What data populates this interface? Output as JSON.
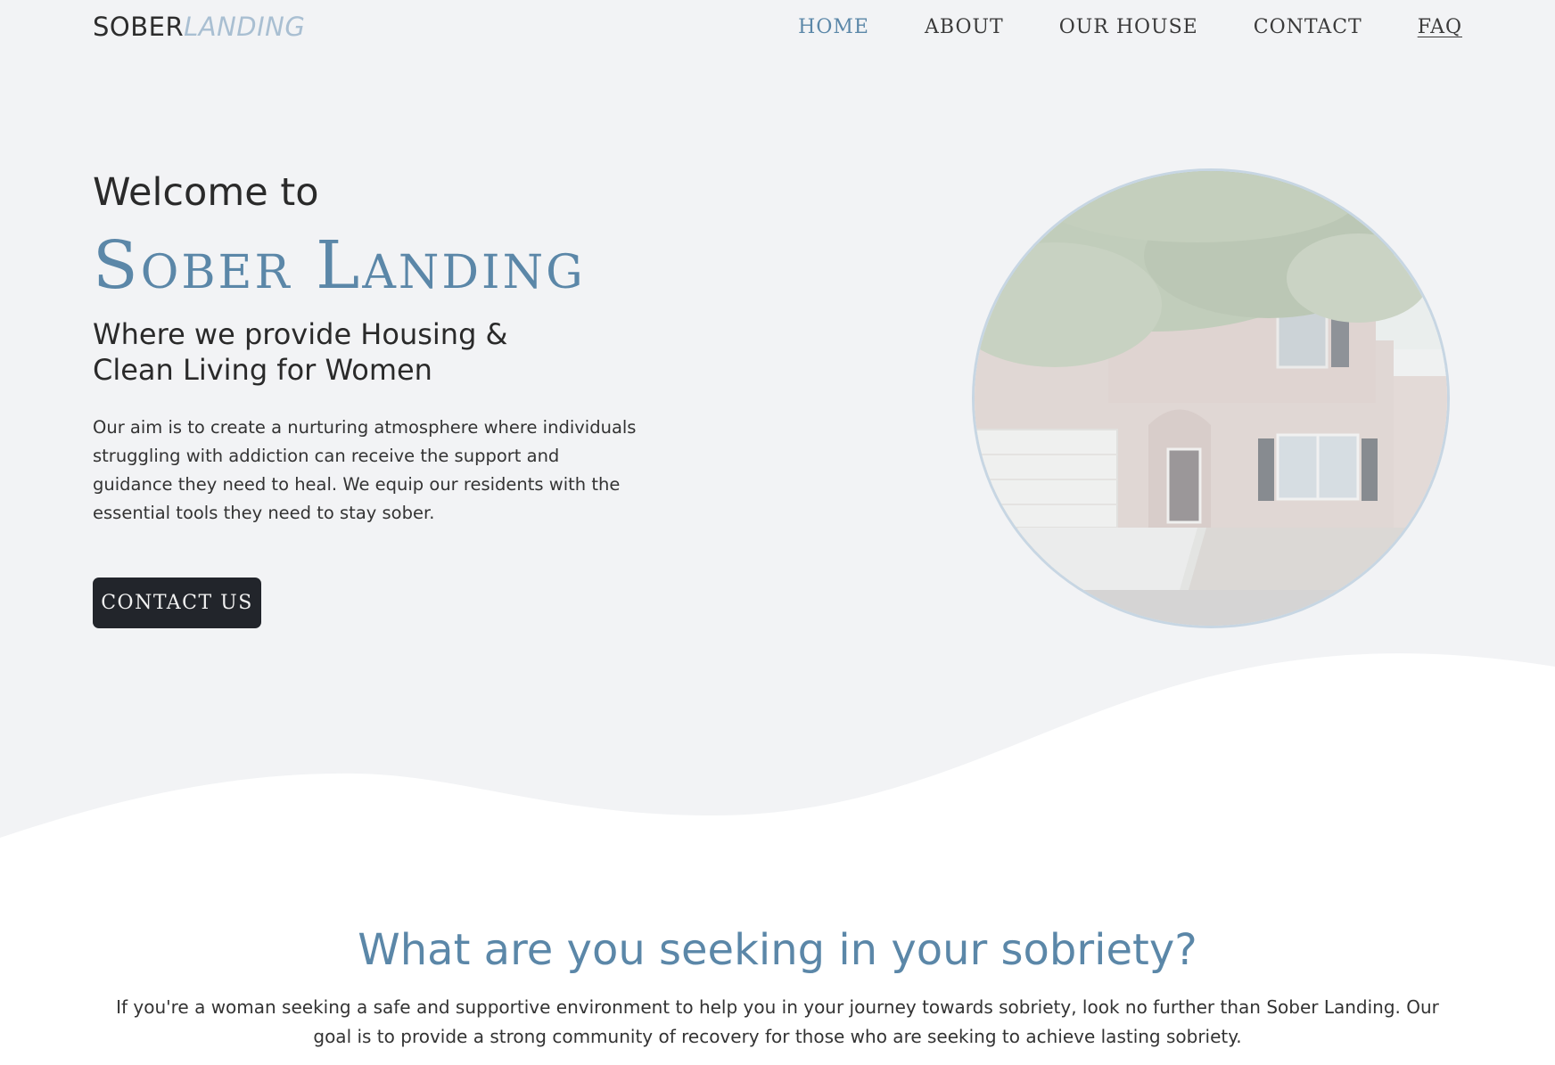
{
  "nav": {
    "logo_part1": "SOBER",
    "logo_part2": "LANDING",
    "links": [
      {
        "label": "HOME"
      },
      {
        "label": "ABOUT"
      },
      {
        "label": "OUR HOUSE"
      },
      {
        "label": "CONTACT"
      },
      {
        "label": "FAQ"
      }
    ]
  },
  "hero": {
    "welcome": "Welcome to",
    "title": "Sober Landing",
    "subtitle": "Where we provide Housing & Clean Living for Women",
    "intro": "Our aim is to create a nurturing atmosphere where individuals struggling with addiction can receive the support and guidance they need to heal. We equip our residents with the essential tools they need to stay sober.",
    "cta_label": "CONTACT US"
  },
  "section2": {
    "title": "What are you seeking in your sobriety?",
    "text": "If you're a woman seeking a safe and supportive environment to help you in your journey towards sobriety, look no further than Sober Landing. Our goal is to provide a strong community of recovery for those who are seeking to achieve lasting sobriety."
  },
  "colors": {
    "hero_background": "#f2f3f5",
    "accent": "#5b87a8",
    "logo_light": "#a9bfd2",
    "button": "#22252b"
  },
  "icons": {
    "house_image": "house-photo"
  }
}
